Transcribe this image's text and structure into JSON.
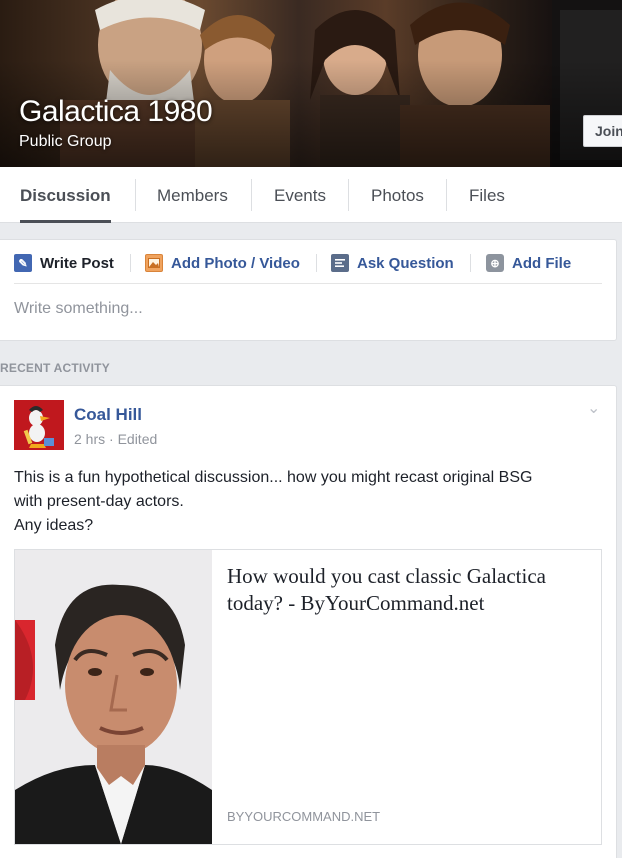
{
  "group": {
    "name": "Galactica 1980",
    "privacy": "Public Group",
    "join_label": "Join"
  },
  "tabs": [
    {
      "label": "Discussion",
      "active": true
    },
    {
      "label": "Members"
    },
    {
      "label": "Events"
    },
    {
      "label": "Photos"
    },
    {
      "label": "Files"
    }
  ],
  "composer": {
    "actions": [
      {
        "label": "Write Post",
        "icon": "pencil-icon"
      },
      {
        "label": "Add Photo / Video",
        "icon": "photo-icon"
      },
      {
        "label": "Ask Question",
        "icon": "question-list-icon"
      },
      {
        "label": "Add File",
        "icon": "add-file-icon"
      }
    ],
    "placeholder": "Write something..."
  },
  "recent_activity_label": "RECENT ACTIVITY",
  "post": {
    "author": "Coal Hill",
    "meta": "2 hrs · Edited",
    "text_lines": [
      "This is a fun hypothetical discussion... how you might recast original BSG",
      "with present-day actors.",
      "Any ideas?"
    ],
    "link": {
      "title": "How would you cast classic Galactica today? - ByYourCommand.net",
      "domain": "BYYOURCOMMAND.NET"
    }
  },
  "colors": {
    "link_blue": "#365899",
    "page_bg": "#e9ebee",
    "muted_text": "#90949c"
  }
}
